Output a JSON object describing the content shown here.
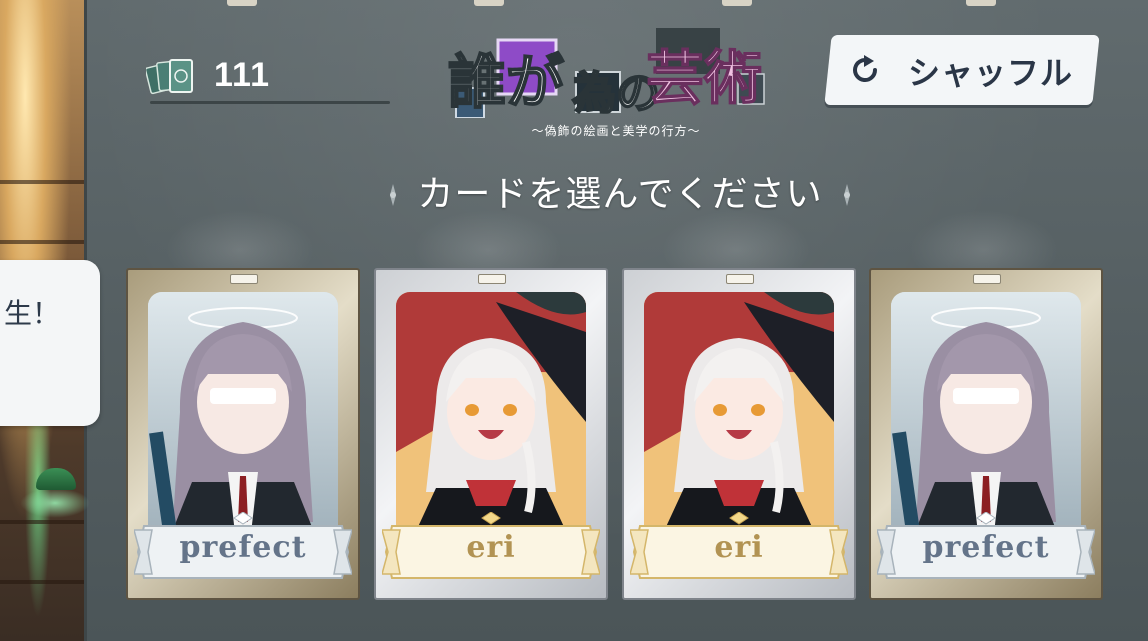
{
  "deck": {
    "count": "111",
    "icon": "card-deck-icon"
  },
  "logo": {
    "title": "誰が為の芸術",
    "subtitle": "〜偽飾の絵画と美学の行方〜"
  },
  "shuffle_button": {
    "label": "シャッフル",
    "icon": "refresh-icon"
  },
  "instruction": "カードを選んでください",
  "speech_bubble": {
    "text": "生！"
  },
  "cards": [
    {
      "label": "prefect",
      "frame": "gold"
    },
    {
      "label": "eri",
      "frame": "silver"
    },
    {
      "label": "eri",
      "frame": "silver"
    },
    {
      "label": "prefect",
      "frame": "gold"
    }
  ],
  "colors": {
    "background": "#5b6568",
    "button_bg": "#f3f6f8",
    "button_text": "#2a3647",
    "prefect_label": "#647489",
    "eri_label": "#b29353",
    "logo_accent": "#e9a8d8"
  }
}
